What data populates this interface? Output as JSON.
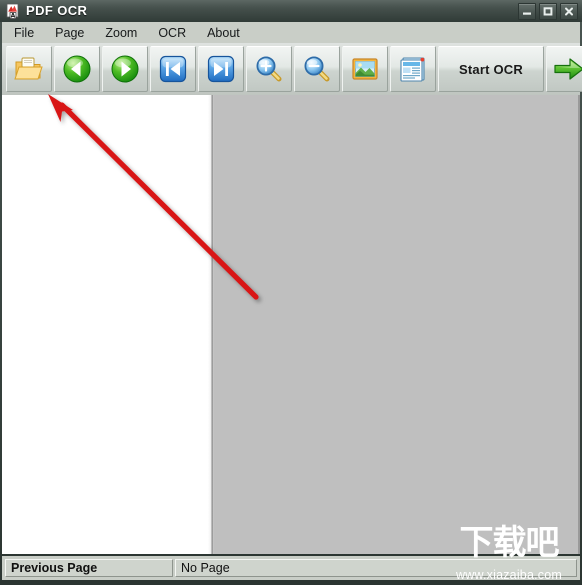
{
  "window": {
    "title": "PDF OCR",
    "icon": "pdf-ocr-app-icon",
    "controls": {
      "minimize": "minimize-button",
      "maximize": "maximize-button",
      "close": "close-button"
    }
  },
  "menubar": {
    "items": [
      {
        "label": "File"
      },
      {
        "label": "Page"
      },
      {
        "label": "Zoom"
      },
      {
        "label": "OCR"
      },
      {
        "label": "About"
      }
    ]
  },
  "toolbar": {
    "buttons": [
      {
        "name": "open-file-button",
        "icon": "open-folder-icon",
        "label": ""
      },
      {
        "name": "previous-page-button",
        "icon": "green-left-arrow-icon",
        "label": ""
      },
      {
        "name": "next-page-button",
        "icon": "green-right-arrow-icon",
        "label": ""
      },
      {
        "name": "first-page-button",
        "icon": "blue-first-page-icon",
        "label": ""
      },
      {
        "name": "last-page-button",
        "icon": "blue-last-page-icon",
        "label": ""
      },
      {
        "name": "zoom-in-button",
        "icon": "magnifier-plus-icon",
        "label": ""
      },
      {
        "name": "zoom-out-button",
        "icon": "magnifier-minus-icon",
        "label": ""
      },
      {
        "name": "view-image-button",
        "icon": "picture-icon",
        "label": ""
      },
      {
        "name": "view-text-button",
        "icon": "document-text-icon",
        "label": ""
      },
      {
        "name": "start-ocr-button",
        "icon": "",
        "label": "Start OCR"
      },
      {
        "name": "go-next-button",
        "icon": "green-arrow-right-icon",
        "label": ""
      }
    ]
  },
  "statusbar": {
    "left_label": "Previous Page",
    "right_label": "No Page"
  },
  "watermark": {
    "logo_text": "下载吧",
    "url": "www.xiazaiba.com"
  },
  "annotation": {
    "type": "red-arrow",
    "points_to": "open-file-button",
    "color": "#d81616"
  },
  "colors": {
    "titlebar": "#46514d",
    "menubar": "#c9cec7",
    "toolbar": "#d4d9d5",
    "left_pane": "#ffffff",
    "right_pane": "#bfbfbf",
    "frame": "#2e3a36",
    "annotation": "#d81616"
  }
}
